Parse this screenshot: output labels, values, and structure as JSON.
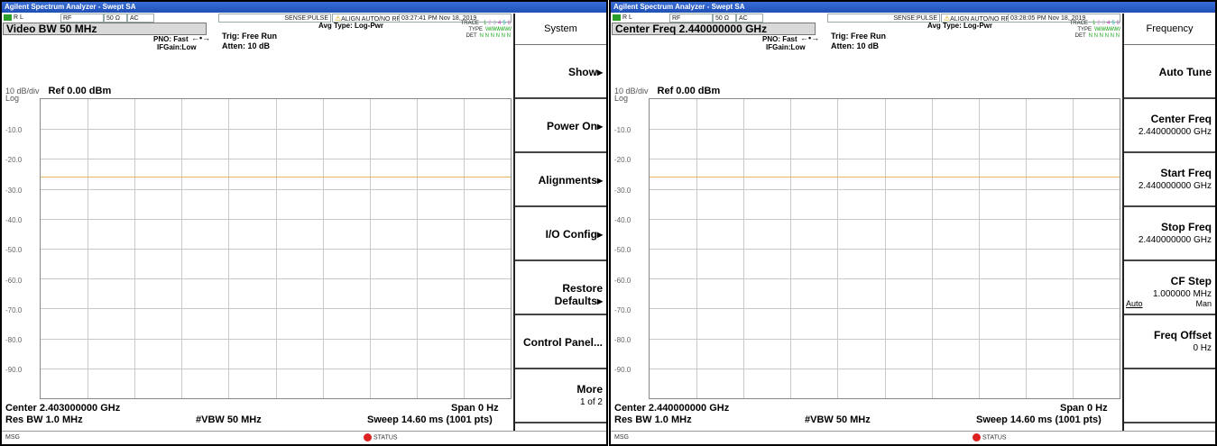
{
  "panels": [
    {
      "window_title": "Agilent Spectrum Analyzer - Swept SA",
      "status": {
        "rl": "R L",
        "rf": "RF",
        "impedance": "50 Ω",
        "coupling": "AC",
        "sense": "SENSE:PULSE",
        "align": "ALIGN AUTO/NO RF",
        "datetime": "03:27:41 PM Nov 18, 2019"
      },
      "active_function": "Video BW 50 MHz",
      "pno": "PNO: Fast",
      "ifgain": "IFGain:Low",
      "trig": "Trig: Free Run",
      "atten": "Atten: 10 dB",
      "avg_type": "Avg Type: Log-Pwr",
      "trace": {
        "trace_label": "TRACE",
        "type_label": "TYPE",
        "det_label": "DET",
        "numbers": [
          "1",
          "2",
          "3",
          "4",
          "5",
          "6"
        ],
        "type_val": "WWWWWW",
        "det_val": "N N N N N N"
      },
      "scale": "10 dB/div",
      "ref": "Ref 0.00 dBm",
      "log": "Log",
      "y_ticks": [
        "-10.0",
        "-20.0",
        "-30.0",
        "-40.0",
        "-50.0",
        "-60.0",
        "-70.0",
        "-80.0",
        "-90.0"
      ],
      "trace_level_dbm": -26,
      "center": "Center 2.403000000 GHz",
      "span": "Span 0 Hz",
      "res_bw": "Res BW 1.0 MHz",
      "vbw": "#VBW 50 MHz",
      "sweep": "Sweep  14.60 ms (1001 pts)",
      "msg": "MSG",
      "status_text": "STATUS",
      "menu_title": "System",
      "softkeys": [
        {
          "label": "Show▸",
          "sub": ""
        },
        {
          "label": "Power On▸",
          "sub": ""
        },
        {
          "label": "Alignments▸",
          "sub": ""
        },
        {
          "label": "I/O Config▸",
          "sub": ""
        },
        {
          "label": "Restore Defaults▸",
          "sub": ""
        },
        {
          "label": "Control Panel...",
          "sub": ""
        },
        {
          "label": "More",
          "sub": "1 of 2"
        }
      ]
    },
    {
      "window_title": "Agilent Spectrum Analyzer - Swept SA",
      "status": {
        "rl": "R L",
        "rf": "RF",
        "impedance": "50 Ω",
        "coupling": "AC",
        "sense": "SENSE:PULSE",
        "align": "ALIGN AUTO/NO RF",
        "datetime": "03:28:05 PM Nov 18, 2019"
      },
      "active_function": "Center Freq 2.440000000 GHz",
      "pno": "PNO: Fast",
      "ifgain": "IFGain:Low",
      "trig": "Trig: Free Run",
      "atten": "Atten: 10 dB",
      "avg_type": "Avg Type: Log-Pwr",
      "trace": {
        "trace_label": "TRACE",
        "type_label": "TYPE",
        "det_label": "DET",
        "numbers": [
          "1",
          "2",
          "3",
          "4",
          "5",
          "6"
        ],
        "type_val": "WWWWWW",
        "det_val": "N N N N N N"
      },
      "scale": "10 dB/div",
      "ref": "Ref 0.00 dBm",
      "log": "Log",
      "y_ticks": [
        "-10.0",
        "-20.0",
        "-30.0",
        "-40.0",
        "-50.0",
        "-60.0",
        "-70.0",
        "-80.0",
        "-90.0"
      ],
      "trace_level_dbm": -26,
      "center": "Center 2.440000000 GHz",
      "span": "Span 0 Hz",
      "res_bw": "Res BW 1.0 MHz",
      "vbw": "#VBW 50 MHz",
      "sweep": "Sweep  14.60 ms (1001 pts)",
      "msg": "MSG",
      "status_text": "STATUS",
      "menu_title": "Frequency",
      "softkeys": [
        {
          "label": "Auto Tune",
          "sub": ""
        },
        {
          "label": "Center Freq",
          "sub": "2.440000000 GHz"
        },
        {
          "label": "Start Freq",
          "sub": "2.440000000 GHz"
        },
        {
          "label": "Stop Freq",
          "sub": "2.440000000 GHz"
        },
        {
          "label": "CF Step",
          "sub": "1.000000 MHz",
          "auto": "Auto",
          "man": "Man"
        },
        {
          "label": "Freq Offset",
          "sub": "0 Hz"
        },
        {
          "label": "",
          "sub": ""
        }
      ]
    }
  ]
}
